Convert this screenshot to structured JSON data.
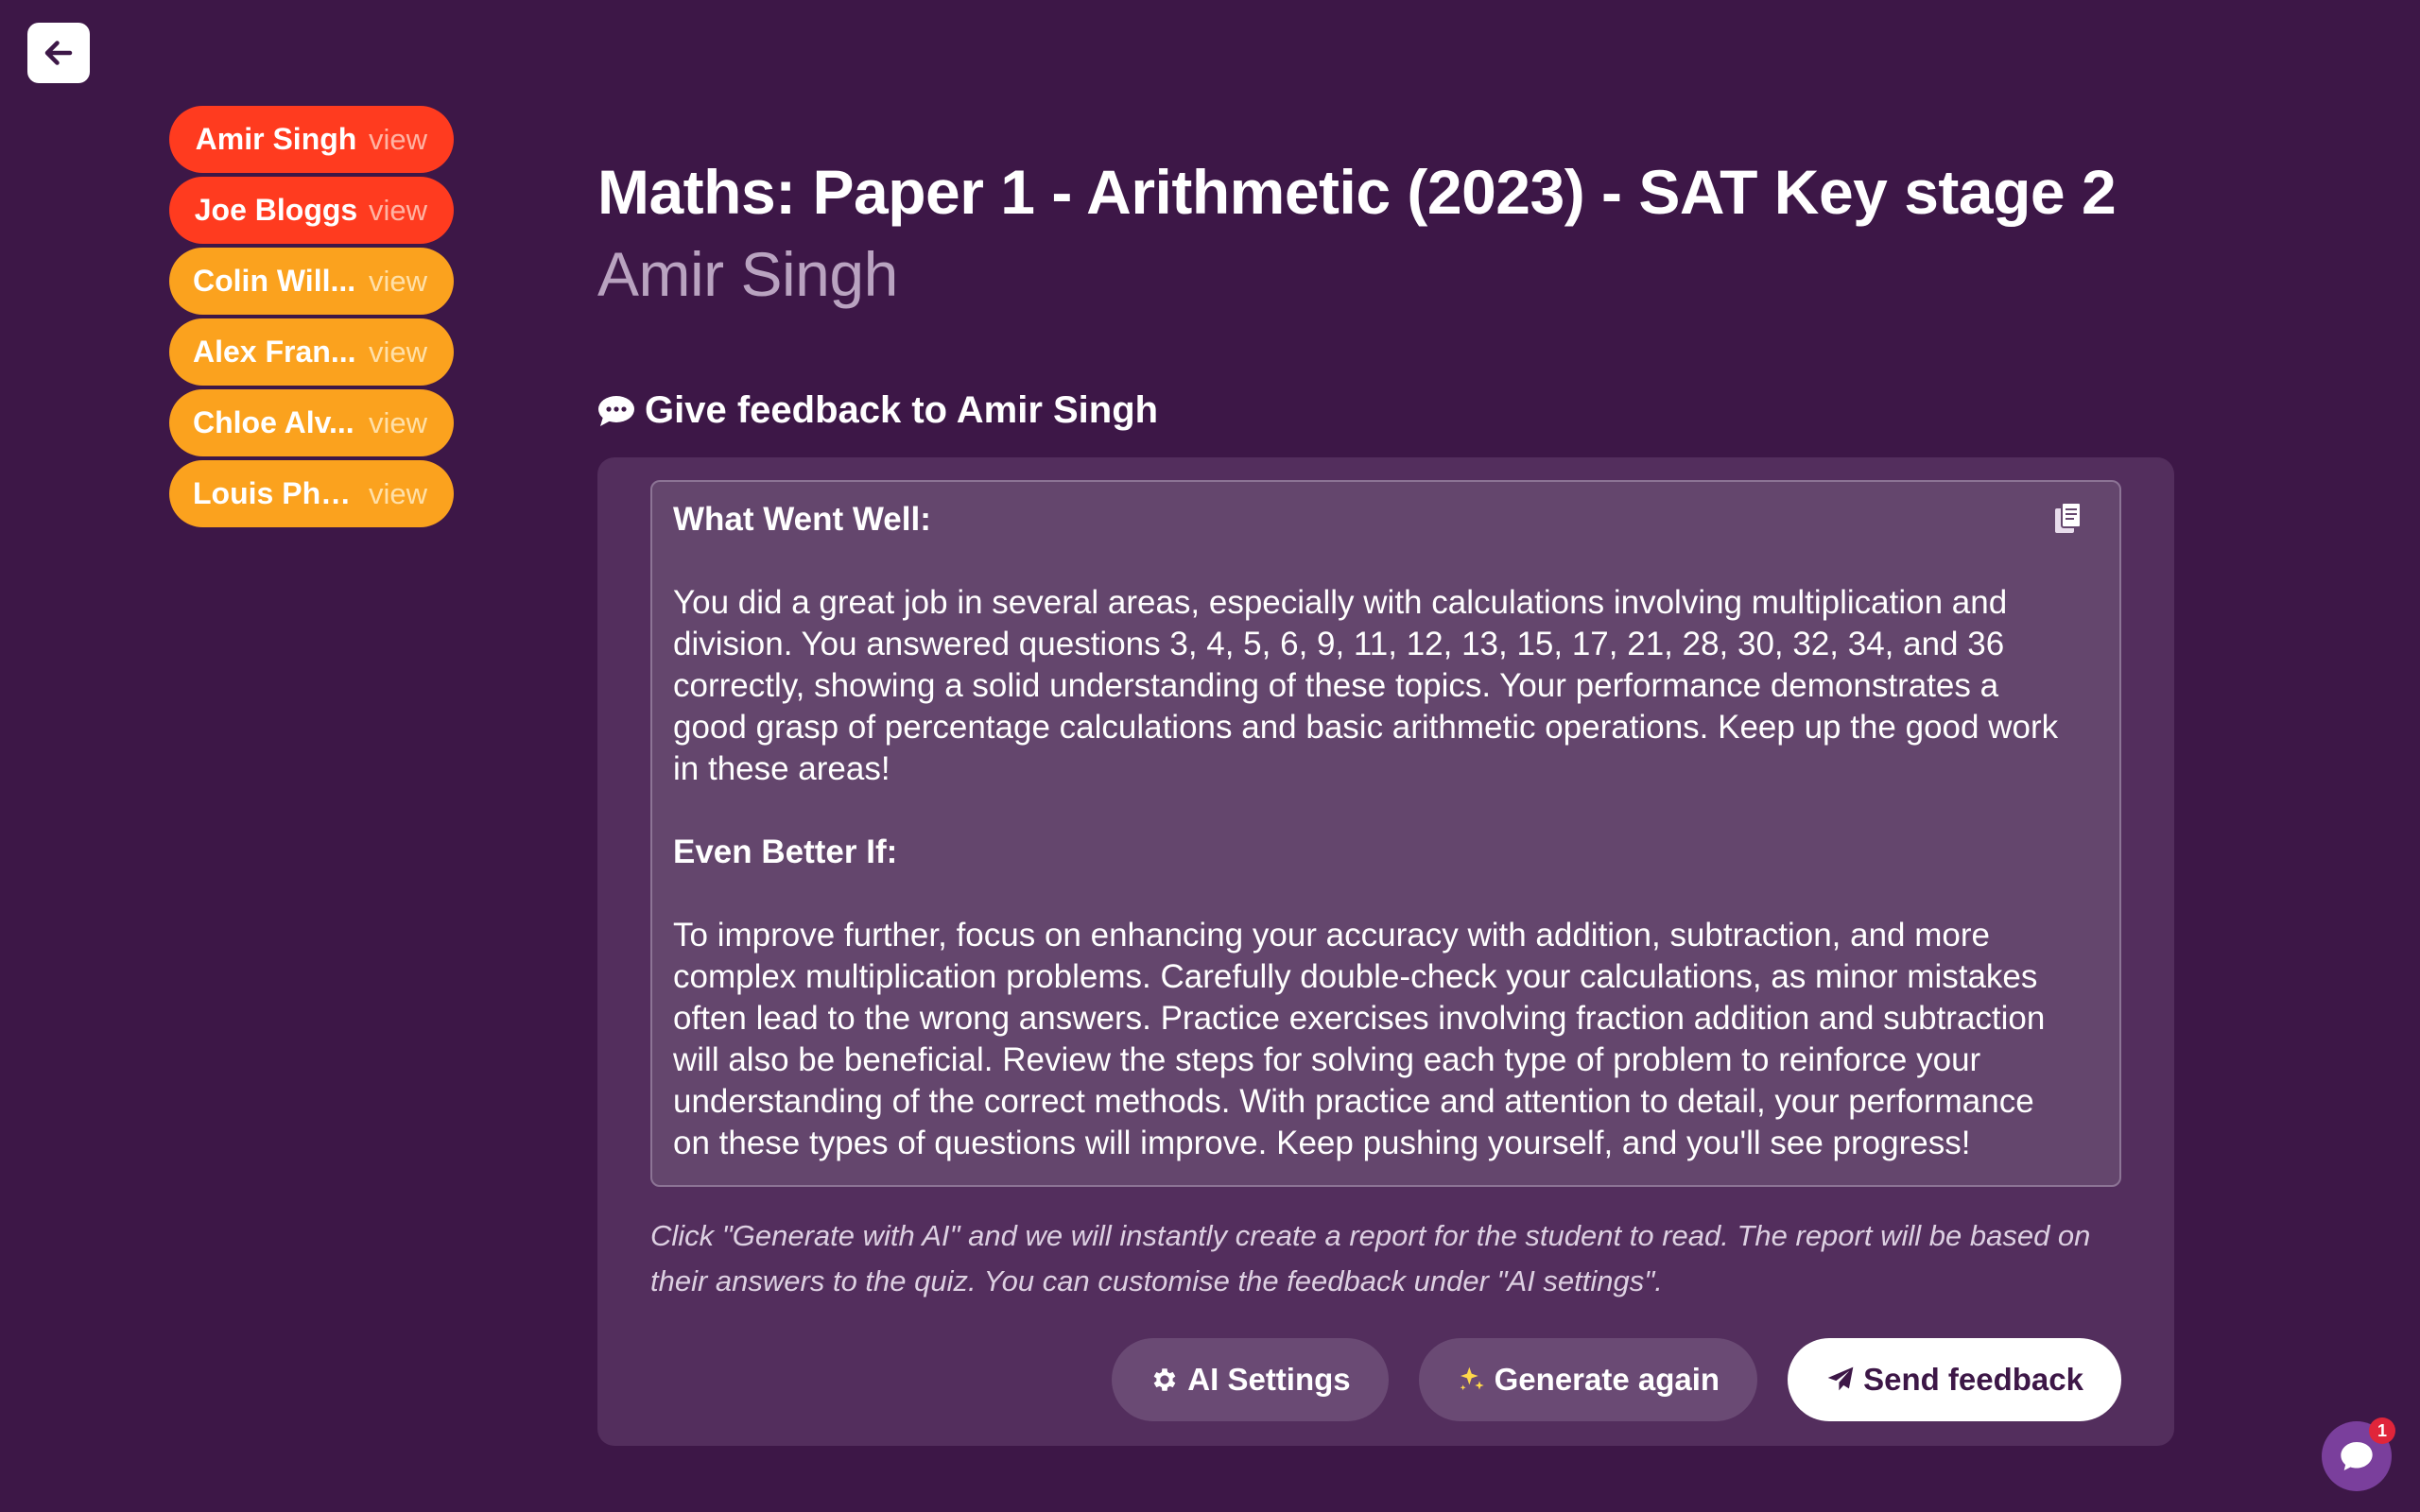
{
  "students": [
    {
      "name": "Amir Singh",
      "view": "view",
      "color": "#ff3b1f"
    },
    {
      "name": "Joe Bloggs",
      "view": "view",
      "color": "#ff3b1f"
    },
    {
      "name": "Colin Will...",
      "view": "view",
      "color": "#fba21e"
    },
    {
      "name": "Alex Fran...",
      "view": "view",
      "color": "#fba21e"
    },
    {
      "name": "Chloe Alv...",
      "view": "view",
      "color": "#fba21e"
    },
    {
      "name": "Louis Phill...",
      "view": "view",
      "color": "#fba21e"
    }
  ],
  "page": {
    "title": "Maths: Paper 1 - Arithmetic (2023) - SAT Key stage 2",
    "student_name": "Amir Singh"
  },
  "feedback": {
    "heading": "Give feedback to Amir Singh",
    "well_heading": "What Went Well:",
    "well_text": "You did a great job in several areas, especially with calculations involving multiplication and division. You answered questions 3, 4, 5, 6, 9, 11, 12, 13, 15, 17, 21, 28, 30, 32, 34, and 36 correctly, showing a solid understanding of these topics. Your performance demonstrates a good grasp of percentage calculations and basic arithmetic operations. Keep up the good work in these areas!",
    "ebi_heading": "Even Better If:",
    "ebi_text": "To improve further, focus on enhancing your accuracy with addition, subtraction, and more complex multiplication problems. Carefully double-check your calculations, as minor mistakes often lead to the wrong answers. Practice exercises involving fraction addition and subtraction will also be beneficial. Review the steps for solving each type of problem to reinforce your understanding of the correct methods. With practice and attention to detail, your performance on these types of questions will improve. Keep pushing yourself, and you'll see progress!",
    "hint": "Click \"Generate with AI\" and we will instantly create a report for the student to read. The report will be based on their answers to the quiz. You can customise the feedback under \"AI settings\"."
  },
  "actions": {
    "ai_settings": "AI Settings",
    "generate_again": "Generate again",
    "send_feedback": "Send feedback"
  },
  "chat": {
    "badge_count": "1"
  },
  "icons": {
    "back": "arrow-left-icon",
    "feedback": "speech-bubble-icon",
    "copy": "copy-icon",
    "settings": "gear-icon",
    "generate": "sparkles-icon",
    "send": "paper-plane-icon",
    "chat": "chat-bubble-icon"
  },
  "colors": {
    "background": "#3d1747",
    "card": "#532e5d",
    "at_risk": "#ff3b1f",
    "warning": "#fba21e"
  }
}
